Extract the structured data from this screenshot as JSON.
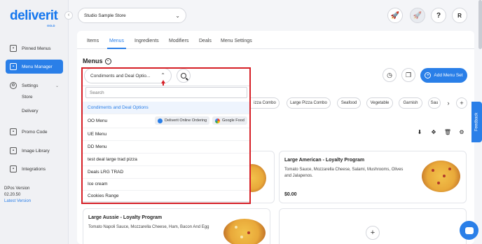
{
  "brand": {
    "name": "deliverit",
    "sub": "GOLD",
    "primary": "#2a7fe8",
    "highlight": "#d61f26"
  },
  "sidebar": {
    "items": [
      {
        "label": "Pinned Menus",
        "icon": "pin-icon"
      },
      {
        "label": "Menu Manager",
        "icon": "menu-book-icon"
      },
      {
        "label": "Settings",
        "icon": "gear-icon"
      },
      {
        "label": "Store"
      },
      {
        "label": "Delivery"
      },
      {
        "label": "Promo Code",
        "icon": "tag-icon"
      },
      {
        "label": "Image Library",
        "icon": "image-icon"
      },
      {
        "label": "Integrations",
        "icon": "link-icon"
      }
    ],
    "version_label": "DPos Version",
    "version_number": "02.20.50",
    "latest_link": "Latest Version"
  },
  "header": {
    "store": "Studio Sample Store",
    "avatar": "R",
    "help": "?"
  },
  "tabs": [
    "Items",
    "Menus",
    "Ingredients",
    "Modifiers",
    "Deals",
    "Menu Settings"
  ],
  "menus": {
    "title": "Menus",
    "selected": "Condiments and Deal Optio...",
    "add_menu_set": "Add Menu Set",
    "chips": [
      "izza Combo",
      "Large Pizza Combo",
      "Seafood",
      "Vegetable",
      "Garnish",
      "Sau"
    ]
  },
  "dropdown": {
    "placeholder": "Search",
    "items": [
      "Condiments and Deal Options",
      "OO Menu",
      "UE Menu",
      "DD Menu",
      "test deal large trad pizza",
      "Deals LRG TRAD",
      "Ice cream",
      "Cookies Range"
    ],
    "badges": [
      "Deliverit Online Ordering",
      "Google Food"
    ]
  },
  "cards": [
    {
      "title": "Large American - Loyalty Program",
      "desc": "Tomato Sauce, Mozzarella Cheese, Salami, Mushrooms, Olives and Jalapenos.",
      "price": "$0.00"
    },
    {
      "title": "Large Aussie - Loyalty Program",
      "desc": "Tomato Napoli Sauce, Mozzarella Cheese, Ham, Bacon And Egg"
    }
  ],
  "feedback": "Feedback"
}
